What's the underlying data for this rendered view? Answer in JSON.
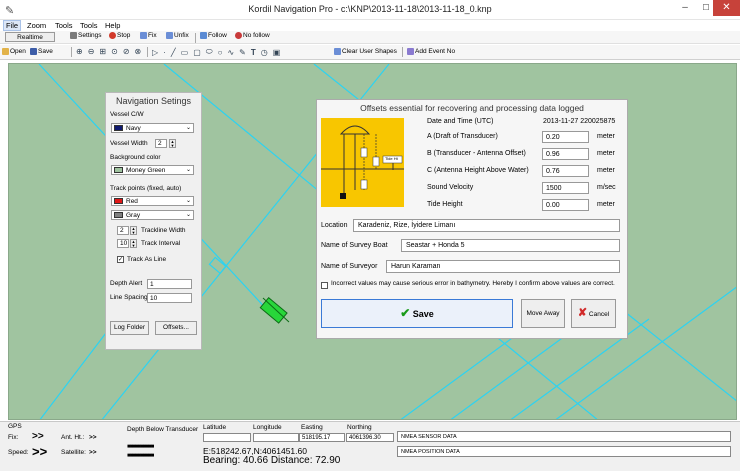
{
  "window": {
    "title": "Kordil Navigation Pro - c:\\KNP\\2013-11-18\\2013-11-18_0.knp",
    "min": "–",
    "max": "☐",
    "close": "✕"
  },
  "menu": [
    "File",
    "Zoom",
    "Tools",
    "Tools",
    "Help"
  ],
  "toolbar1": {
    "realtime": "Realtime",
    "settings": "Settings",
    "stop": "Stop",
    "fix": "Fix",
    "unfix": "Unfix",
    "follow": "Follow",
    "no_follow": "No follow"
  },
  "toolbar2": {
    "open": "Open",
    "save": "Save",
    "clear_shapes": "Clear User Shapes",
    "add_event": "Add Event No"
  },
  "nav_settings": {
    "title": "Navigation Setings",
    "vessel_cw_label": "Vessel C/W",
    "vessel_color": "Navy",
    "vessel_width_label": "Vessel Width",
    "vessel_width": "2",
    "bg_color_label": "Background color",
    "bg_color": "Money Green",
    "track_points_label": "Track points (fixed, auto)",
    "track_fixed_color": "Red",
    "track_auto_color": "Gray",
    "trackline_width": "2",
    "trackline_width_label": "Trackline Width",
    "track_interval": "10",
    "track_interval_label": "Track Interval",
    "track_as_line_label": "Track As Line",
    "depth_alert_label": "Depth Alert",
    "depth_alert": "1",
    "line_spacing_label": "Line Spacing",
    "line_spacing": "10",
    "log_folder": "Log Folder",
    "offsets": "Offsets..."
  },
  "offsets_dialog": {
    "title": "Offsets essential for recovering and processing data logged",
    "date_label": "Date and Time (UTC)",
    "date_value": "2013-11-27 220025875",
    "draft_label": "A (Draft of Transducer)",
    "draft_value": "0.20",
    "antenna_offset_label": "B (Transducer - Antenna Offset)",
    "antenna_offset_value": "0.96",
    "antenna_height_label": "C (Antenna Height Above Water)",
    "antenna_height_value": "0.76",
    "sound_velocity_label": "Sound Velocity",
    "sound_velocity_value": "1500",
    "tide_height_label": "Tide Height",
    "tide_height_value": "0.00",
    "unit_meter": "meter",
    "unit_msec": "m/sec",
    "location_label": "Location",
    "location_value": "Karadeniz, Rize, İyidere Limanı",
    "boat_label": "Name of Survey Boat",
    "boat_value": "Seastar + Honda 5",
    "surveyor_label": "Name of Surveyor",
    "surveyor_value": "Harun Karaman",
    "warning": "Incorrect values may cause serious error in bathymetry. Hereby I confirm above values are correct.",
    "save": "Save",
    "move_away": "Move Away",
    "cancel": "Cancel",
    "diagram_tide": "Tide Ht"
  },
  "status": {
    "gps_label": "GPS",
    "fix_label": "Fix:",
    "speed_label": "Speed:",
    "ant_ht_label": "Ant. Ht.:",
    "satellite_label": "Satellite:",
    "depth_label": "Depth Below Transducer",
    "latitude_label": "Latitude",
    "longitude_label": "Longitude",
    "easting_label": "Easting",
    "northing_label": "Northing",
    "easting_value": "518195.17",
    "northing_value": "4061396.30",
    "en_readout": "E:518242.67,N:4061451.60",
    "bearing_readout": "Bearing: 40.66 Distance: 72.90",
    "nmea_sensor": "NMEA SENSOR DATA",
    "nmea_position": "NMEA POSITION DATA",
    "arrows": ">>",
    "dots": "■■■■■■■■■■"
  }
}
